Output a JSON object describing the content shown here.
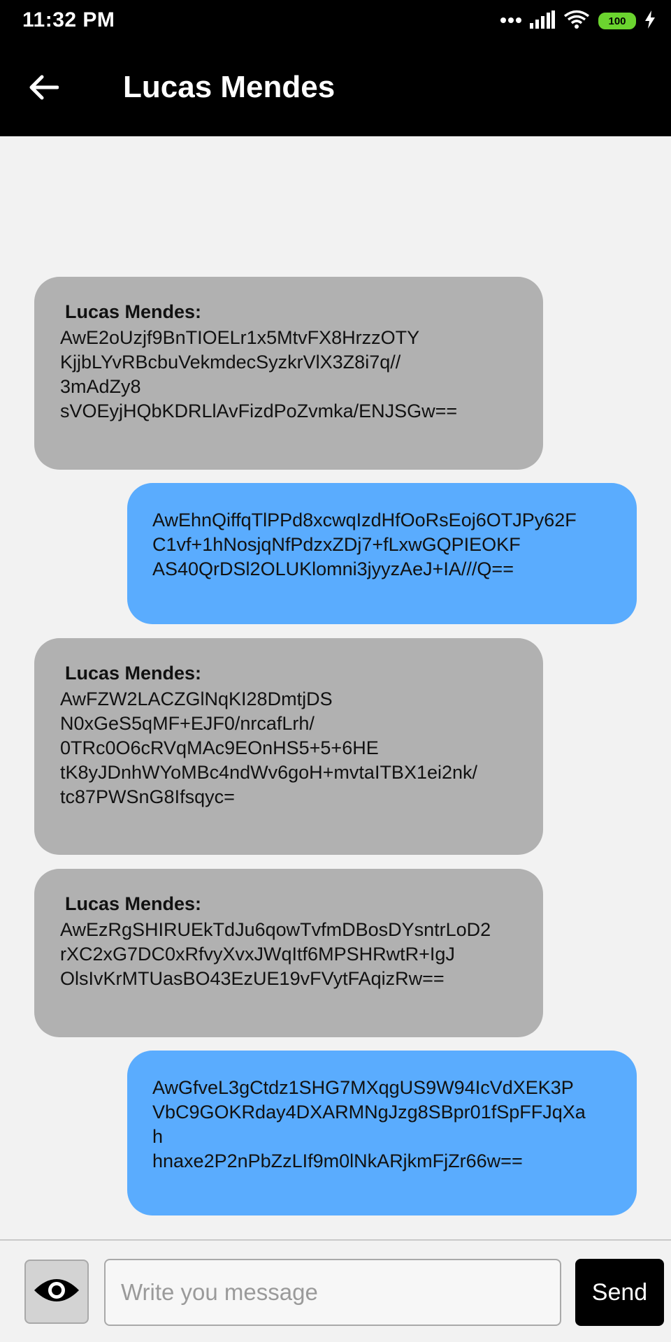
{
  "status_bar": {
    "time": "11:32 PM",
    "battery_level": "100",
    "icons": [
      "more-dots-icon",
      "signal-icon",
      "wifi-icon",
      "battery-icon",
      "charging-icon"
    ]
  },
  "header": {
    "title": "Lucas Mendes",
    "back_icon": "arrow-left-icon"
  },
  "messages": [
    {
      "direction": "incoming",
      "sender": "Lucas Mendes:",
      "text": "AwE2oUzjf9BnTIOELr1x5MtvFX8HrzzOTY\nKjjbLYvRBcbuVekmdecSyzkrVlX3Z8i7q//\n3mAdZy8\nsVOEyjHQbKDRLlAvFizdPoZvmka/ENJSGw=="
    },
    {
      "direction": "outgoing",
      "text": "AwEhnQiffqTlPPd8xcwqIzdHfOoRsEoj6OTJPy62F\nC1vf+1hNosjqNfPdzxZDj7+fLxwGQPIEOKF\nAS40QrDSl2OLUKlomni3jyyzAeJ+IA///Q=="
    },
    {
      "direction": "incoming",
      "sender": "Lucas Mendes:",
      "text": "AwFZW2LACZGlNqKI28DmtjDS\nN0xGeS5qMF+EJF0/nrcafLrh/\n0TRc0O6cRVqMAc9EOnHS5+5+6HE\ntK8yJDnhWYoMBc4ndWv6goH+mvtaITBX1ei2nk/\ntc87PWSnG8Ifsqyc="
    },
    {
      "direction": "incoming",
      "sender": "Lucas Mendes:",
      "text": "AwEzRgSHIRUEkTdJu6qowTvfmDBosDYsntrLoD2\nrXC2xG7DC0xRfvyXvxJWqItf6MPSHRwtR+IgJ\nOlsIvKrMTUasBO43EzUE19vFVytFAqizRw=="
    },
    {
      "direction": "outgoing",
      "text": "AwGfveL3gCtdz1SHG7MXqgUS9W94IcVdXEK3P\nVbC9GOKRday4DXARMNgJzg8SBpr01fSpFFJqXa\nh\nhnaxe2P2nPbZzLIf9m0lNkARjkmFjZr66w=="
    }
  ],
  "composer": {
    "eye_icon": "eye-icon",
    "input_value": "",
    "input_placeholder": "Write you message",
    "send_label": "Send"
  },
  "colors": {
    "incoming_bubble": "#b1b1b1",
    "outgoing_bubble": "#5aacfe",
    "app_bar": "#000000",
    "background": "#f2f2f2",
    "battery": "#6bd42f"
  }
}
